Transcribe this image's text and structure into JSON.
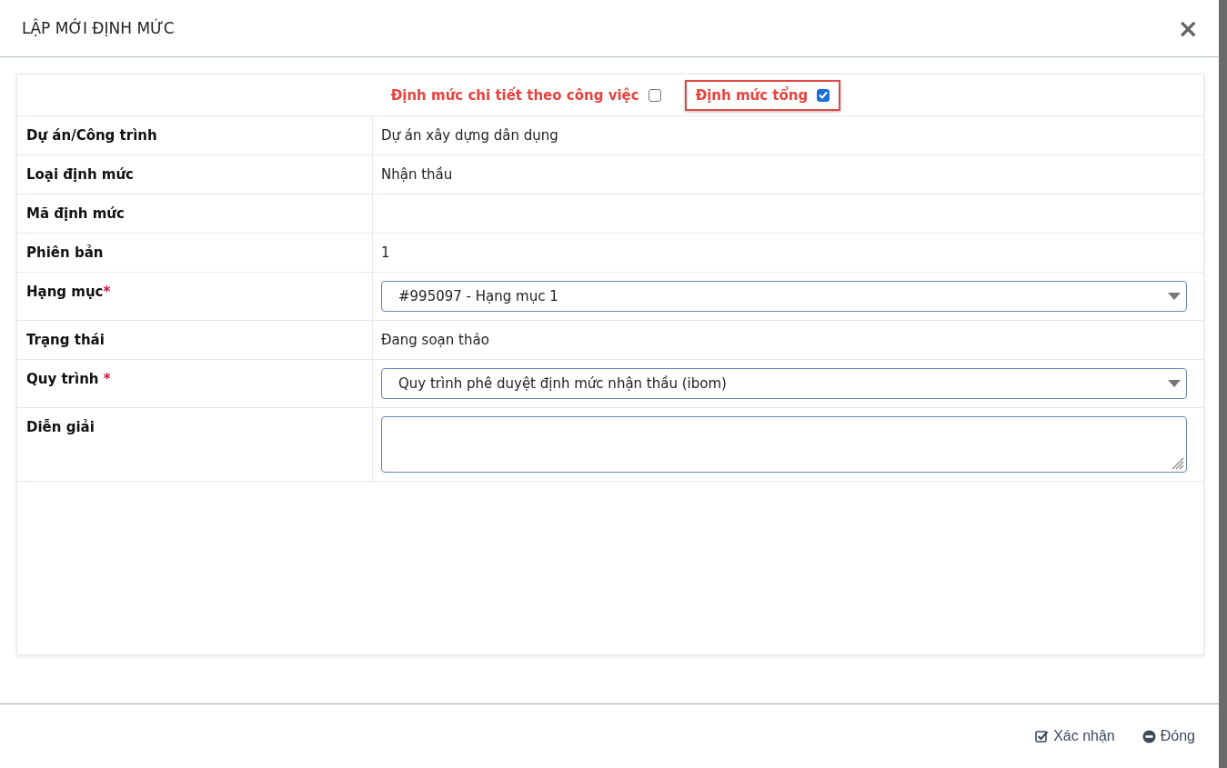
{
  "dialog": {
    "title": "LẬP MỚI ĐỊNH MỨC",
    "close": "×"
  },
  "mode_options": [
    {
      "label": "Định mức chi tiết theo công việc",
      "checked": false,
      "highlighted": false
    },
    {
      "label": "Định mức tổng",
      "checked": true,
      "highlighted": true
    }
  ],
  "fields": [
    {
      "kind": "text",
      "label": "Dự án/Công trình",
      "value": "Dự án xây dựng dân dụng"
    },
    {
      "kind": "text",
      "label": "Loại định mức",
      "value": "Nhận thầu"
    },
    {
      "kind": "text",
      "label": "Mã định mức"
    },
    {
      "kind": "text",
      "label": "Phiên bản",
      "value": "1"
    },
    {
      "kind": "select",
      "label": "Hạng mục",
      "required_mark": "*",
      "value": "#995097 - Hạng mục 1"
    },
    {
      "kind": "text",
      "label": "Trạng thái",
      "value": "Đang soạn thảo"
    },
    {
      "kind": "select",
      "label": "Quy trình ",
      "required_mark": "*",
      "value": "Quy trình phê duyệt định mức nhận thầu (ibom)"
    },
    {
      "kind": "textarea",
      "label": "Diễn giải"
    }
  ],
  "footer_buttons": [
    {
      "kind": "confirm",
      "label": "Xác nhận"
    },
    {
      "kind": "close",
      "label": "Đóng"
    }
  ]
}
